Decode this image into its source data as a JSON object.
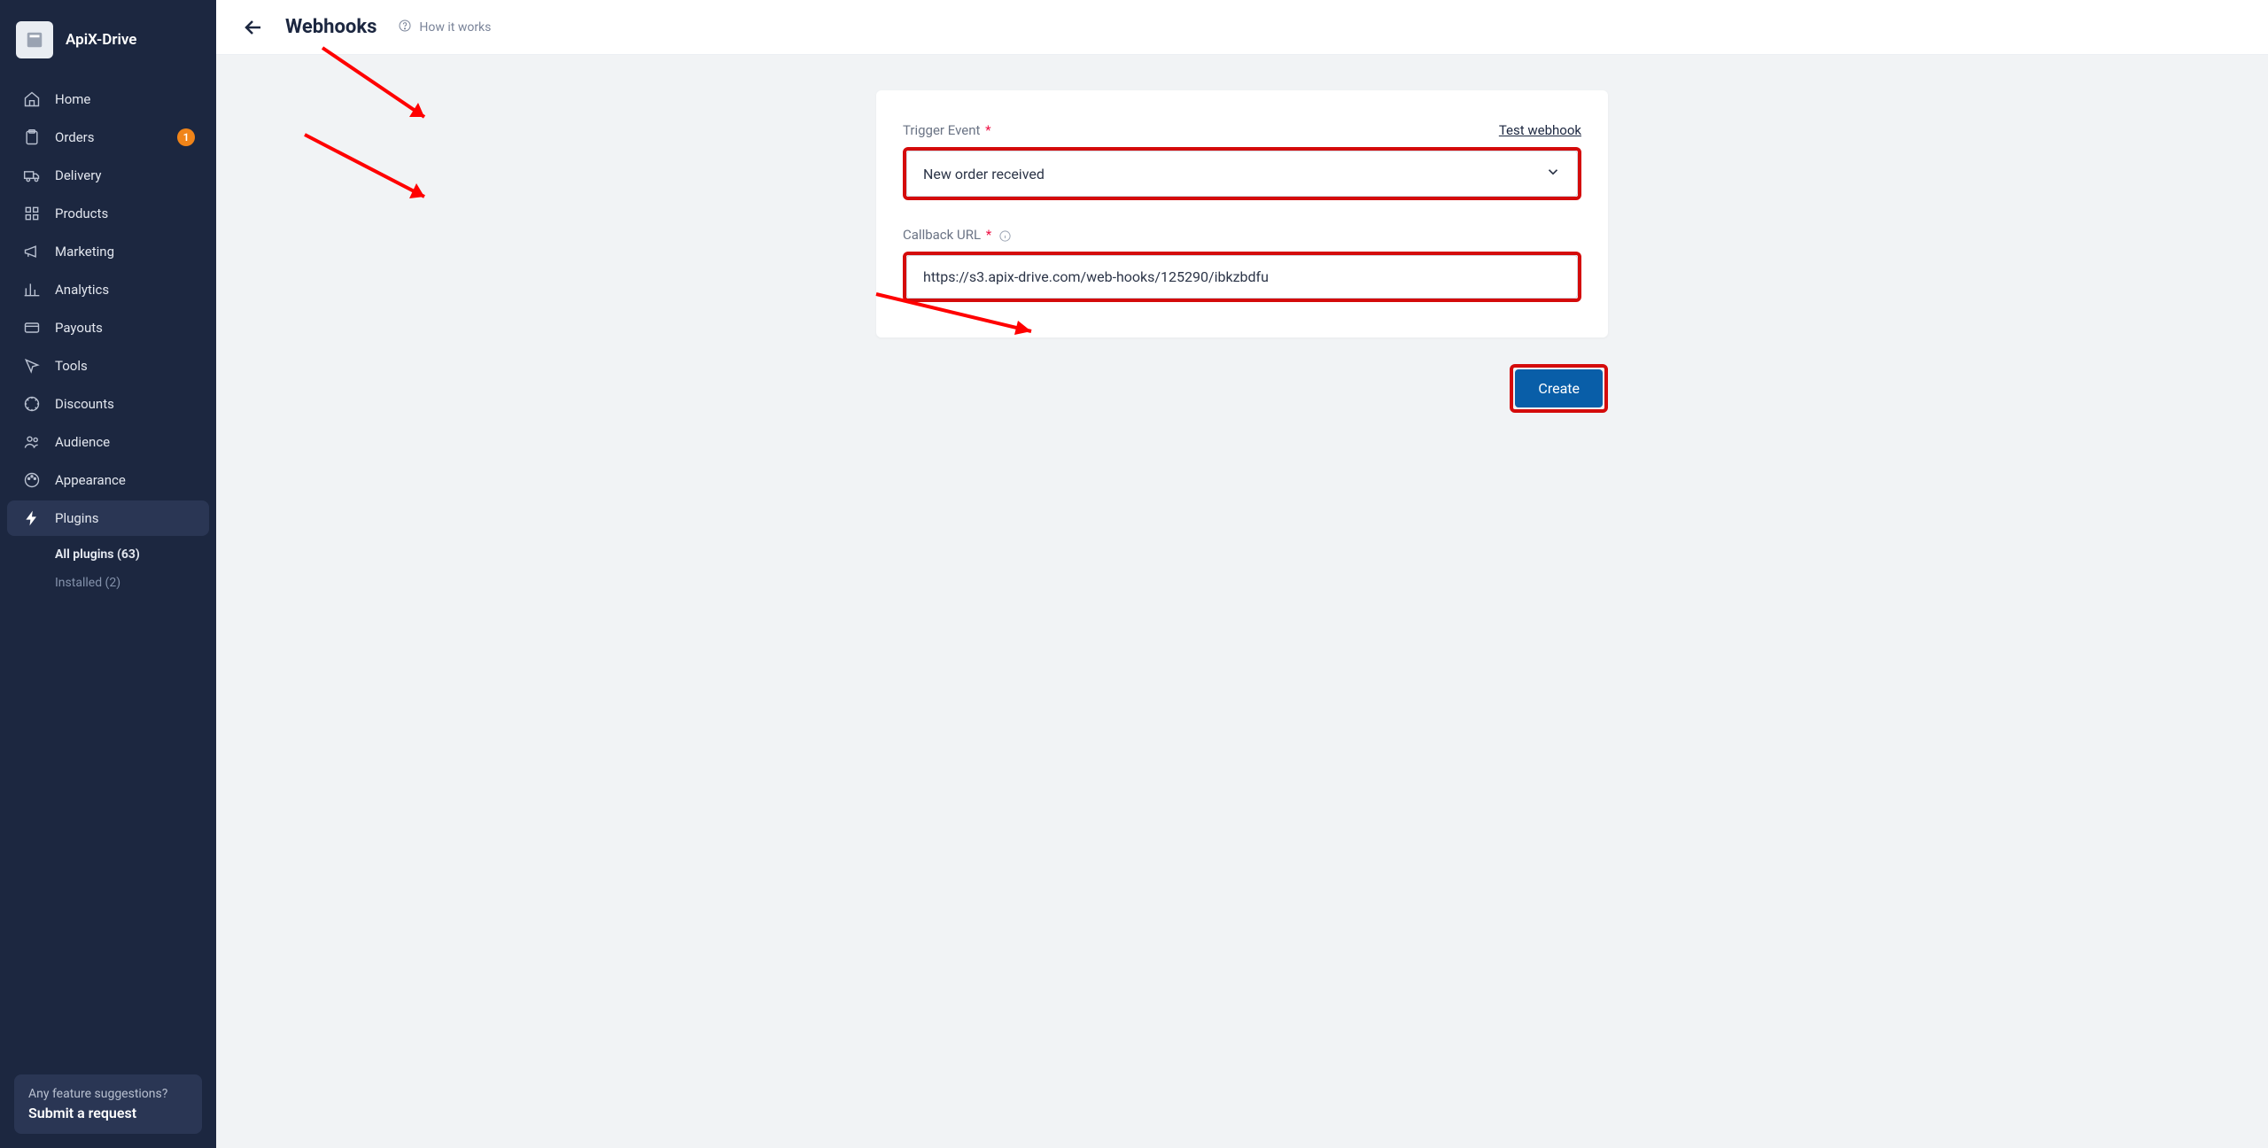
{
  "brand": "ApiX-Drive",
  "nav": {
    "home": "Home",
    "orders": "Orders",
    "orders_badge": "1",
    "delivery": "Delivery",
    "products": "Products",
    "marketing": "Marketing",
    "analytics": "Analytics",
    "payouts": "Payouts",
    "tools": "Tools",
    "discounts": "Discounts",
    "audience": "Audience",
    "appearance": "Appearance",
    "plugins": "Plugins"
  },
  "subnav": {
    "all_plugins": "All plugins (63)",
    "installed": "Installed (2)"
  },
  "footer": {
    "hint": "Any feature suggestions?",
    "cta": "Submit a request"
  },
  "topbar": {
    "title": "Webhooks",
    "how": "How it works"
  },
  "form": {
    "trigger_label": "Trigger Event",
    "test_link": "Test webhook",
    "trigger_value": "New order received",
    "callback_label": "Callback URL",
    "callback_value": "https://s3.apix-drive.com/web-hooks/125290/ibkzbdfu",
    "create_button": "Create"
  }
}
